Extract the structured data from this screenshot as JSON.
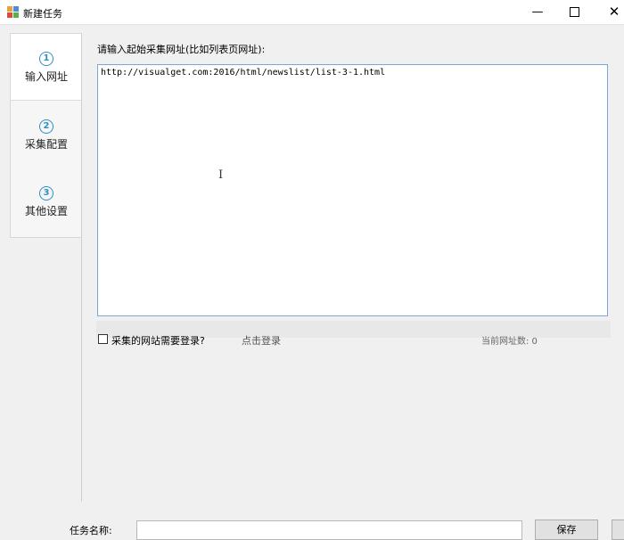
{
  "window": {
    "title": "新建任务",
    "minimize_glyph": "—",
    "close_glyph": "✕"
  },
  "sidebar": {
    "steps": [
      {
        "number": "1",
        "label": "输入网址",
        "active": true
      },
      {
        "number": "2",
        "label": "采集配置",
        "active": false
      },
      {
        "number": "3",
        "label": "其他设置",
        "active": false
      }
    ]
  },
  "main": {
    "prompt": "请输入起始采集网址(比如列表页网址):",
    "url_text": "http://visualget.com:2016/html/newslist/list-3-1.html",
    "cursor_glyph": "I"
  },
  "options": {
    "login_required_label": "采集的网站需要登录?",
    "login_required_checked": false,
    "login_link": "点击登录",
    "url_count": "当前网址数: 0"
  },
  "footer": {
    "task_name_label": "任务名称:",
    "task_name_value": "",
    "save_label": "保存"
  },
  "colors": {
    "accent": "#2f8fc0",
    "input_border": "#7aa7d8"
  }
}
